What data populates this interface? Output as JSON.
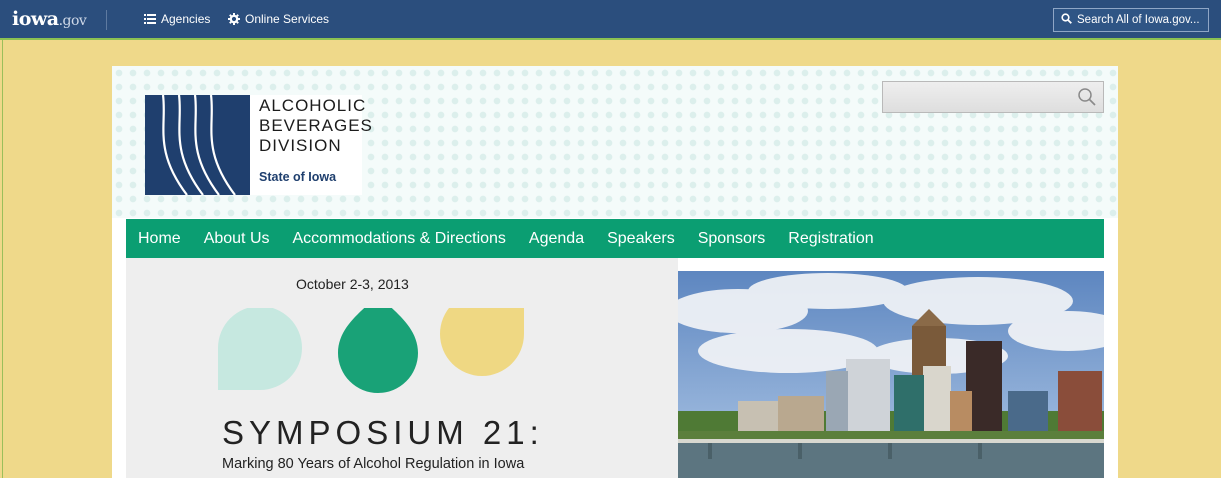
{
  "gov_bar": {
    "logo_main": "iowa",
    "logo_suffix": ".gov",
    "agencies_label": "Agencies",
    "online_services_label": "Online Services",
    "search_placeholder": "Search All of Iowa.gov..."
  },
  "header": {
    "logo_line1": "ALCOHOLIC",
    "logo_line2": "BEVERAGES",
    "logo_line3": "DIVISION",
    "logo_sub": "State of Iowa"
  },
  "nav": {
    "items": [
      {
        "label": "Home"
      },
      {
        "label": "About Us"
      },
      {
        "label": "Accommodations & Directions"
      },
      {
        "label": "Agenda"
      },
      {
        "label": "Speakers"
      },
      {
        "label": "Sponsors"
      },
      {
        "label": "Registration"
      }
    ]
  },
  "event": {
    "date": "October 2-3, 2013",
    "title": "SYMPOSIUM 21:",
    "subtitle": "Marking 80 Years of Alcohol Regulation in Iowa"
  },
  "colors": {
    "gov_blue": "#2b4e7d",
    "background": "#efd98a",
    "nav_green": "#0b9e72",
    "drop_light": "#c6e8e0",
    "drop_mid": "#19a277",
    "drop_yellow": "#efd883",
    "logo_navy": "#1f3f6e"
  }
}
